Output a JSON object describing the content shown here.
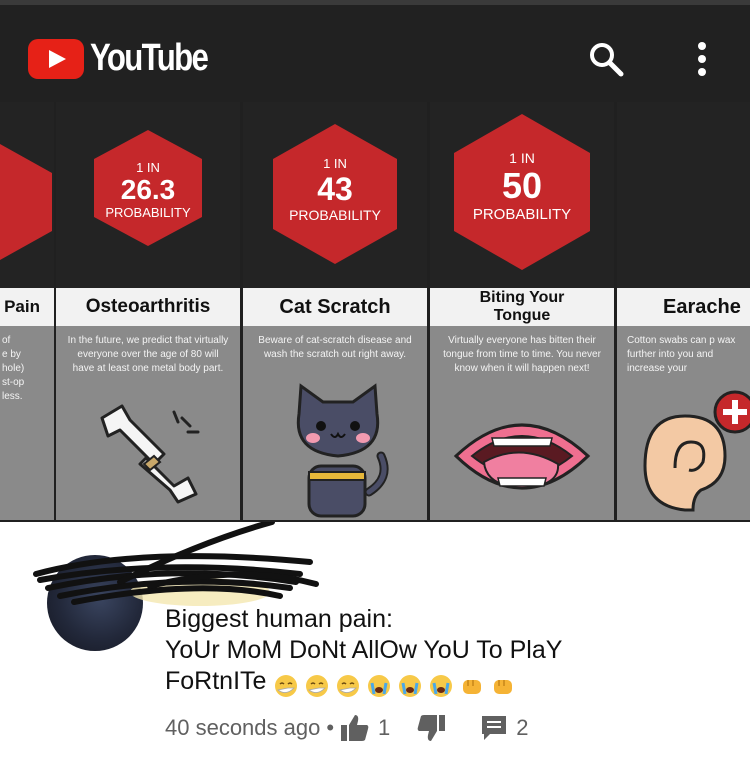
{
  "app": {
    "logo_text": "YouTube"
  },
  "header": {
    "search_icon": "search-icon",
    "more_icon": "more-vert-icon"
  },
  "infographic": {
    "cards": [
      {
        "probability_prefix": "",
        "probability_value": "",
        "probability_word": "",
        "label": "Pain",
        "description": "of\ne by\nhole)\nst-op\nless."
      },
      {
        "probability_prefix": "1 IN",
        "probability_value": "26.3",
        "probability_word": "PROBABILITY",
        "label": "Osteoarthritis",
        "description": "In the future, we predict that virtually everyone over the age of 80 will have at least one metal body part."
      },
      {
        "probability_prefix": "1 IN",
        "probability_value": "43",
        "probability_word": "PROBABILITY",
        "label": "Cat Scratch",
        "description": "Beware of cat-scratch disease and wash the scratch out right away."
      },
      {
        "probability_prefix": "1 IN",
        "probability_value": "50",
        "probability_word": "PROBABILITY",
        "label": "Biting Your Tongue",
        "description": "Virtually everyone has bitten their tongue from time to time. You never know when it will happen next!"
      },
      {
        "probability_prefix": "",
        "probability_value": "",
        "probability_word": "",
        "label": "Earache",
        "description": "Cotton swabs can p wax further into you and increase your"
      }
    ],
    "colors": {
      "hex_red": "#c5282b",
      "panel_dark": "#232323",
      "desc_gray": "#8a8a8a"
    }
  },
  "comment": {
    "lines": [
      "Biggest human pain:",
      "YoUr MoM DoNt AllOw YoU To PlaY",
      "FoRtnITe"
    ],
    "emojis": [
      "sneezing-face",
      "sneezing-face",
      "sneezing-face",
      "loudly-crying-face",
      "loudly-crying-face",
      "loudly-crying-face",
      "oncoming-fist",
      "oncoming-fist"
    ],
    "timestamp": "40 seconds ago",
    "separator": "•",
    "likes": "1",
    "replies": "2"
  }
}
